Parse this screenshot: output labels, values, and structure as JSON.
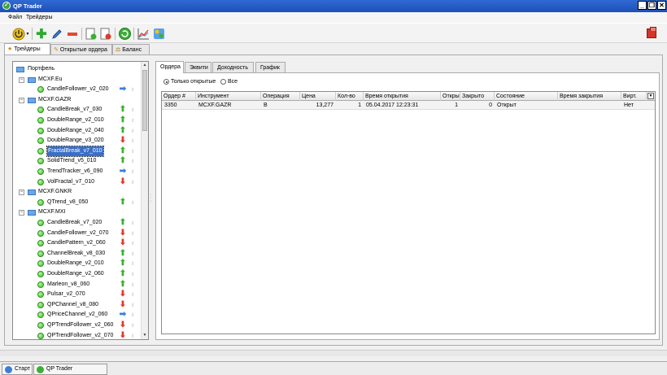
{
  "window": {
    "title": "QP Trader"
  },
  "menu": [
    {
      "label": "Файл"
    },
    {
      "label": "Трейдеры"
    }
  ],
  "main_tabs": [
    {
      "label": "Трейдеры",
      "icon": "trader-icon",
      "active": true
    },
    {
      "label": "Открытые ордера",
      "icon": "orders-icon",
      "active": false
    },
    {
      "label": "Баланс",
      "icon": "balance-icon",
      "active": false
    }
  ],
  "tree": {
    "root": "Портфель",
    "groups": [
      {
        "name": "MCXF.Eu",
        "items": [
          {
            "name": "CandleFollower_v2_020",
            "signal": "right"
          }
        ]
      },
      {
        "name": "MCXF.GAZR",
        "items": [
          {
            "name": "CandleBreak_v7_030",
            "signal": "up"
          },
          {
            "name": "DoubleRange_v2_010",
            "signal": "up"
          },
          {
            "name": "DoubleRange_v2_040",
            "signal": "up"
          },
          {
            "name": "DoubleRange_v3_020",
            "signal": "down"
          },
          {
            "name": "FractalBreak_v7_010",
            "signal": "up",
            "selected": true
          },
          {
            "name": "SolidTrend_v5_010",
            "signal": "up"
          },
          {
            "name": "TrendTracker_v6_090",
            "signal": "right"
          },
          {
            "name": "VolFractal_v7_010",
            "signal": "down"
          }
        ]
      },
      {
        "name": "MCXF.GNKR",
        "items": [
          {
            "name": "QTrend_v8_050",
            "signal": "up"
          }
        ]
      },
      {
        "name": "MCXF.MXI",
        "items": [
          {
            "name": "CandleBreak_v7_020",
            "signal": "up"
          },
          {
            "name": "CandleFollower_v2_070",
            "signal": "down"
          },
          {
            "name": "CandlePattern_v2_060",
            "signal": "down"
          },
          {
            "name": "ChannelBreak_v8_030",
            "signal": "up"
          },
          {
            "name": "DoubleRange_v2_010",
            "signal": "up"
          },
          {
            "name": "DoubleRange_v2_060",
            "signal": "up"
          },
          {
            "name": "Marleon_v8_060",
            "signal": "up"
          },
          {
            "name": "Pulsar_v2_070",
            "signal": "down"
          },
          {
            "name": "QPChannel_v8_080",
            "signal": "down"
          },
          {
            "name": "QPriceChannel_v2_060",
            "signal": "right"
          },
          {
            "name": "QPTrendFollower_v2_060",
            "signal": "down"
          },
          {
            "name": "QPTrendFollower_v2_070",
            "signal": "down"
          }
        ]
      }
    ]
  },
  "inner_tabs": [
    {
      "label": "Ордера",
      "active": true
    },
    {
      "label": "Эквити",
      "active": false
    },
    {
      "label": "Доходность",
      "active": false
    },
    {
      "label": "График",
      "active": false
    }
  ],
  "filter": {
    "open_only": "Только открытые",
    "all": "Все",
    "selected": "open_only"
  },
  "orders": {
    "columns": [
      "Ордер #",
      "Инструмент",
      "Операция",
      "Цена",
      "Кол-во",
      "Время открытия",
      "Открыто",
      "Закрыто",
      "Состояние",
      "Время закрытия",
      "Вирт."
    ],
    "rows": [
      [
        "3350",
        "MCXF.GAZR",
        "B",
        "13,277",
        "1",
        "05.04.2017 12:23:31",
        "1",
        "0",
        "Открыт",
        "",
        "Нет"
      ]
    ]
  },
  "taskbar": [
    {
      "label": "Старт",
      "icon": "start-icon"
    },
    {
      "label": "QP Trader",
      "icon": "app-icon"
    }
  ]
}
